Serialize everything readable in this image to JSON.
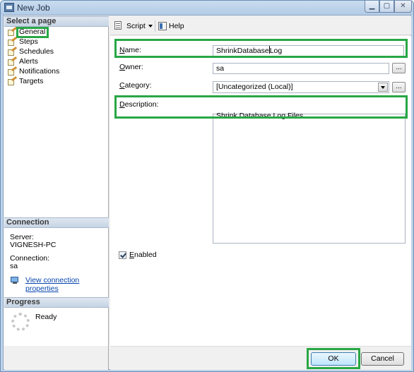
{
  "window": {
    "title": "New Job",
    "minimize": "▁",
    "maximize": "▢",
    "close": "✕"
  },
  "left": {
    "select_page_header": "Select a page",
    "pages": [
      {
        "label": "General"
      },
      {
        "label": "Steps"
      },
      {
        "label": "Schedules"
      },
      {
        "label": "Alerts"
      },
      {
        "label": "Notifications"
      },
      {
        "label": "Targets"
      }
    ],
    "connection_header": "Connection",
    "server_label": "Server:",
    "server_value": "VIGNESH-PC",
    "connection_label": "Connection:",
    "connection_value": "sa",
    "view_connection_link": "View connection properties",
    "progress_header": "Progress",
    "progress_status": "Ready"
  },
  "toolbar": {
    "script_label": "Script",
    "help_label": "Help"
  },
  "form": {
    "name_label_u": "N",
    "name_label_rest": "ame:",
    "name_value_a": "ShrinkDatabase",
    "name_value_b": "Log",
    "owner_label_u": "O",
    "owner_label_rest": "wner:",
    "owner_value": "sa",
    "category_label_u": "C",
    "category_label_rest": "ategory:",
    "category_value": "[Uncategorized (Local)]",
    "description_label_u": "D",
    "description_label_rest": "escription:",
    "description_value": "Shrink Database Log Files",
    "enabled_label_u": "E",
    "enabled_label_rest": "nabled",
    "enabled_checked": true,
    "ellipsis": "..."
  },
  "buttons": {
    "ok_label": "OK",
    "cancel_label": "Cancel"
  },
  "highlight_color": "#28a745"
}
